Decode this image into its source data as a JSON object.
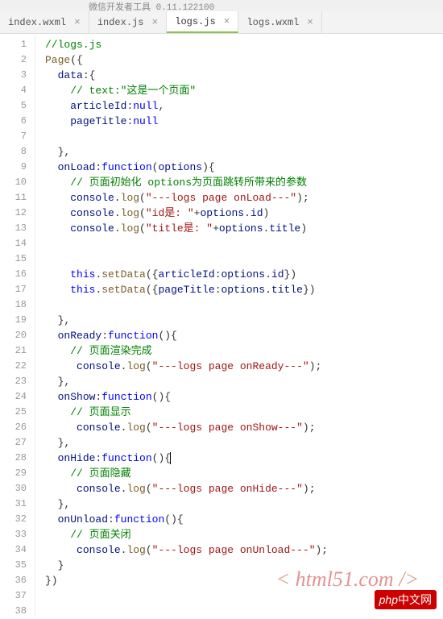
{
  "topbar": "微信开发者工具 0.11.122100",
  "tabs": [
    {
      "label": "index.wxml",
      "active": false
    },
    {
      "label": "index.js",
      "active": false
    },
    {
      "label": "logs.js",
      "active": true
    },
    {
      "label": "logs.wxml",
      "active": false
    }
  ],
  "lines": [
    {
      "n": 1,
      "t": [
        {
          "c": "c-comment",
          "v": "//logs.js"
        }
      ]
    },
    {
      "n": 2,
      "t": [
        {
          "c": "c-func",
          "v": "Page"
        },
        {
          "c": "",
          "v": "({"
        }
      ]
    },
    {
      "n": 3,
      "t": [
        {
          "c": "",
          "v": "  "
        },
        {
          "c": "c-ident",
          "v": "data"
        },
        {
          "c": "",
          "v": ":{"
        }
      ]
    },
    {
      "n": 4,
      "t": [
        {
          "c": "",
          "v": "    "
        },
        {
          "c": "c-comment",
          "v": "// text:\"这是一个页面\""
        }
      ]
    },
    {
      "n": 5,
      "t": [
        {
          "c": "",
          "v": "    "
        },
        {
          "c": "c-ident",
          "v": "articleId"
        },
        {
          "c": "",
          "v": ":"
        },
        {
          "c": "c-key",
          "v": "null"
        },
        {
          "c": "",
          "v": ","
        }
      ]
    },
    {
      "n": 6,
      "t": [
        {
          "c": "",
          "v": "    "
        },
        {
          "c": "c-ident",
          "v": "pageTitle"
        },
        {
          "c": "",
          "v": ":"
        },
        {
          "c": "c-key",
          "v": "null"
        }
      ]
    },
    {
      "n": 7,
      "t": [
        {
          "c": "",
          "v": ""
        }
      ]
    },
    {
      "n": 8,
      "t": [
        {
          "c": "",
          "v": "  },"
        }
      ]
    },
    {
      "n": 9,
      "t": [
        {
          "c": "",
          "v": "  "
        },
        {
          "c": "c-ident",
          "v": "onLoad"
        },
        {
          "c": "",
          "v": ":"
        },
        {
          "c": "c-key",
          "v": "function"
        },
        {
          "c": "",
          "v": "("
        },
        {
          "c": "c-ident",
          "v": "options"
        },
        {
          "c": "",
          "v": "){"
        }
      ]
    },
    {
      "n": 10,
      "t": [
        {
          "c": "",
          "v": "    "
        },
        {
          "c": "c-comment",
          "v": "// 页面初始化 options为页面跳转所带来的参数"
        }
      ]
    },
    {
      "n": 11,
      "t": [
        {
          "c": "",
          "v": "    "
        },
        {
          "c": "c-ident",
          "v": "console"
        },
        {
          "c": "",
          "v": "."
        },
        {
          "c": "c-func",
          "v": "log"
        },
        {
          "c": "",
          "v": "("
        },
        {
          "c": "c-str",
          "v": "\"---logs page onLoad---\""
        },
        {
          "c": "",
          "v": ");"
        }
      ]
    },
    {
      "n": 12,
      "t": [
        {
          "c": "",
          "v": "    "
        },
        {
          "c": "c-ident",
          "v": "console"
        },
        {
          "c": "",
          "v": "."
        },
        {
          "c": "c-func",
          "v": "log"
        },
        {
          "c": "",
          "v": "("
        },
        {
          "c": "c-str",
          "v": "\"id是: \""
        },
        {
          "c": "",
          "v": "+"
        },
        {
          "c": "c-ident",
          "v": "options"
        },
        {
          "c": "",
          "v": "."
        },
        {
          "c": "c-ident",
          "v": "id"
        },
        {
          "c": "",
          "v": ")"
        }
      ]
    },
    {
      "n": 13,
      "t": [
        {
          "c": "",
          "v": "    "
        },
        {
          "c": "c-ident",
          "v": "console"
        },
        {
          "c": "",
          "v": "."
        },
        {
          "c": "c-func",
          "v": "log"
        },
        {
          "c": "",
          "v": "("
        },
        {
          "c": "c-str",
          "v": "\"title是: \""
        },
        {
          "c": "",
          "v": "+"
        },
        {
          "c": "c-ident",
          "v": "options"
        },
        {
          "c": "",
          "v": "."
        },
        {
          "c": "c-ident",
          "v": "title"
        },
        {
          "c": "",
          "v": ")"
        }
      ]
    },
    {
      "n": 14,
      "t": [
        {
          "c": "",
          "v": ""
        }
      ]
    },
    {
      "n": 15,
      "t": [
        {
          "c": "",
          "v": ""
        }
      ]
    },
    {
      "n": 16,
      "t": [
        {
          "c": "",
          "v": "    "
        },
        {
          "c": "c-key",
          "v": "this"
        },
        {
          "c": "",
          "v": "."
        },
        {
          "c": "c-func",
          "v": "setData"
        },
        {
          "c": "",
          "v": "({"
        },
        {
          "c": "c-ident",
          "v": "articleId"
        },
        {
          "c": "",
          "v": ":"
        },
        {
          "c": "c-ident",
          "v": "options"
        },
        {
          "c": "",
          "v": "."
        },
        {
          "c": "c-ident",
          "v": "id"
        },
        {
          "c": "",
          "v": "})"
        }
      ]
    },
    {
      "n": 17,
      "t": [
        {
          "c": "",
          "v": "    "
        },
        {
          "c": "c-key",
          "v": "this"
        },
        {
          "c": "",
          "v": "."
        },
        {
          "c": "c-func",
          "v": "setData"
        },
        {
          "c": "",
          "v": "({"
        },
        {
          "c": "c-ident",
          "v": "pageTitle"
        },
        {
          "c": "",
          "v": ":"
        },
        {
          "c": "c-ident",
          "v": "options"
        },
        {
          "c": "",
          "v": "."
        },
        {
          "c": "c-ident",
          "v": "title"
        },
        {
          "c": "",
          "v": "})"
        }
      ]
    },
    {
      "n": 18,
      "t": [
        {
          "c": "",
          "v": ""
        }
      ]
    },
    {
      "n": 19,
      "t": [
        {
          "c": "",
          "v": "  },"
        }
      ]
    },
    {
      "n": 20,
      "t": [
        {
          "c": "",
          "v": "  "
        },
        {
          "c": "c-ident",
          "v": "onReady"
        },
        {
          "c": "",
          "v": ":"
        },
        {
          "c": "c-key",
          "v": "function"
        },
        {
          "c": "",
          "v": "(){"
        }
      ]
    },
    {
      "n": 21,
      "t": [
        {
          "c": "",
          "v": "    "
        },
        {
          "c": "c-comment",
          "v": "// 页面渲染完成"
        }
      ]
    },
    {
      "n": 22,
      "t": [
        {
          "c": "",
          "v": "     "
        },
        {
          "c": "c-ident",
          "v": "console"
        },
        {
          "c": "",
          "v": "."
        },
        {
          "c": "c-func",
          "v": "log"
        },
        {
          "c": "",
          "v": "("
        },
        {
          "c": "c-str",
          "v": "\"---logs page onReady---\""
        },
        {
          "c": "",
          "v": ");"
        }
      ]
    },
    {
      "n": 23,
      "t": [
        {
          "c": "",
          "v": "  },"
        }
      ]
    },
    {
      "n": 24,
      "t": [
        {
          "c": "",
          "v": "  "
        },
        {
          "c": "c-ident",
          "v": "onShow"
        },
        {
          "c": "",
          "v": ":"
        },
        {
          "c": "c-key",
          "v": "function"
        },
        {
          "c": "",
          "v": "(){"
        }
      ]
    },
    {
      "n": 25,
      "t": [
        {
          "c": "",
          "v": "    "
        },
        {
          "c": "c-comment",
          "v": "// 页面显示"
        }
      ]
    },
    {
      "n": 26,
      "t": [
        {
          "c": "",
          "v": "     "
        },
        {
          "c": "c-ident",
          "v": "console"
        },
        {
          "c": "",
          "v": "."
        },
        {
          "c": "c-func",
          "v": "log"
        },
        {
          "c": "",
          "v": "("
        },
        {
          "c": "c-str",
          "v": "\"---logs page onShow---\""
        },
        {
          "c": "",
          "v": ");"
        }
      ]
    },
    {
      "n": 27,
      "t": [
        {
          "c": "",
          "v": "  },"
        }
      ]
    },
    {
      "n": 28,
      "t": [
        {
          "c": "",
          "v": "  "
        },
        {
          "c": "c-ident",
          "v": "onHide"
        },
        {
          "c": "",
          "v": ":"
        },
        {
          "c": "c-key",
          "v": "function"
        },
        {
          "c": "",
          "v": "(){"
        },
        {
          "c": "cursor",
          "v": ""
        }
      ]
    },
    {
      "n": 29,
      "t": [
        {
          "c": "",
          "v": "    "
        },
        {
          "c": "c-comment",
          "v": "// 页面隐藏"
        }
      ]
    },
    {
      "n": 30,
      "t": [
        {
          "c": "",
          "v": "     "
        },
        {
          "c": "c-ident",
          "v": "console"
        },
        {
          "c": "",
          "v": "."
        },
        {
          "c": "c-func",
          "v": "log"
        },
        {
          "c": "",
          "v": "("
        },
        {
          "c": "c-str",
          "v": "\"---logs page onHide---\""
        },
        {
          "c": "",
          "v": ");"
        }
      ]
    },
    {
      "n": 31,
      "t": [
        {
          "c": "",
          "v": "  },"
        }
      ]
    },
    {
      "n": 32,
      "t": [
        {
          "c": "",
          "v": "  "
        },
        {
          "c": "c-ident",
          "v": "onUnload"
        },
        {
          "c": "",
          "v": ":"
        },
        {
          "c": "c-key",
          "v": "function"
        },
        {
          "c": "",
          "v": "(){"
        }
      ]
    },
    {
      "n": 33,
      "t": [
        {
          "c": "",
          "v": "    "
        },
        {
          "c": "c-comment",
          "v": "// 页面关闭"
        }
      ]
    },
    {
      "n": 34,
      "t": [
        {
          "c": "",
          "v": "     "
        },
        {
          "c": "c-ident",
          "v": "console"
        },
        {
          "c": "",
          "v": "."
        },
        {
          "c": "c-func",
          "v": "log"
        },
        {
          "c": "",
          "v": "("
        },
        {
          "c": "c-str",
          "v": "\"---logs page onUnload---\""
        },
        {
          "c": "",
          "v": ");"
        }
      ]
    },
    {
      "n": 35,
      "t": [
        {
          "c": "",
          "v": "  }"
        }
      ]
    },
    {
      "n": 36,
      "t": [
        {
          "c": "",
          "v": "})"
        }
      ]
    },
    {
      "n": 37,
      "t": [
        {
          "c": "",
          "v": ""
        }
      ]
    },
    {
      "n": 38,
      "t": [
        {
          "c": "",
          "v": ""
        }
      ]
    }
  ],
  "watermark1": {
    "pre": "< ",
    "mid": "html51.com",
    "post": " />"
  },
  "watermark2": {
    "php": "php",
    "rest": "中文网"
  }
}
